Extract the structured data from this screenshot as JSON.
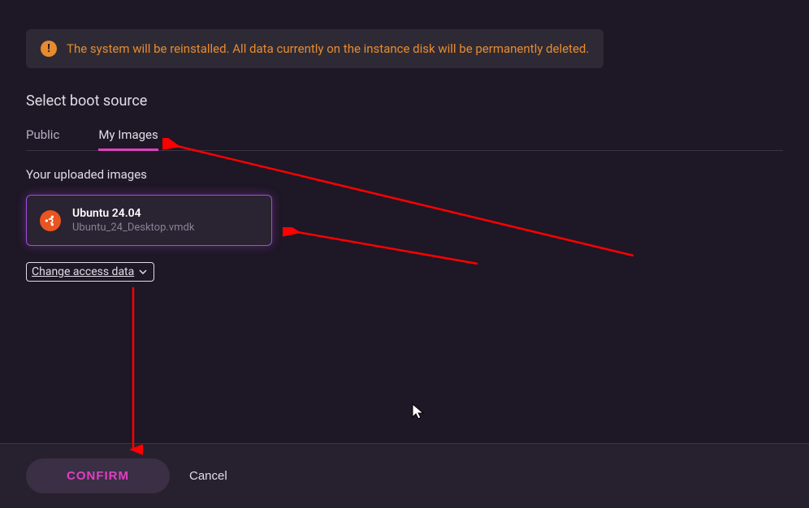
{
  "warning": {
    "text": "The system will be reinstalled. All data currently on the instance disk will be permanently deleted."
  },
  "section_title": "Select boot source",
  "tabs": {
    "public": "Public",
    "my_images": "My Images"
  },
  "sub_heading": "Your uploaded images",
  "image": {
    "name": "Ubuntu 24.04",
    "filename": "Ubuntu_24_Desktop.vmdk"
  },
  "access_select_label": "Change access data",
  "footer": {
    "confirm": "CONFIRM",
    "cancel": "Cancel"
  }
}
